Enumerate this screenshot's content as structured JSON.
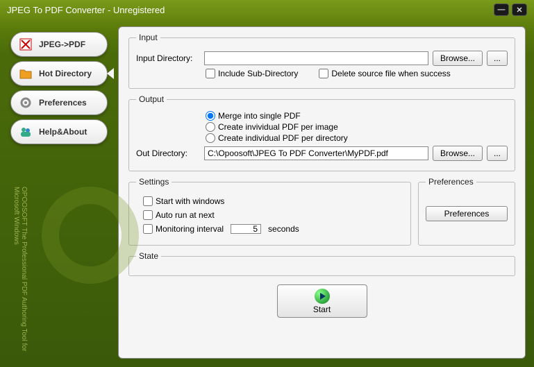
{
  "window": {
    "title": "JPEG To PDF Converter - Unregistered"
  },
  "nav": {
    "jpeg_pdf": "JPEG->PDF",
    "hot_dir": "Hot Directory",
    "prefs": "Preferences",
    "help": "Help&About"
  },
  "sidetext": "OPOOSOFT  The Professional PDF Authoring Tool for Microsoft Windows",
  "input": {
    "legend": "Input",
    "dir_label": "Input Directory:",
    "dir_value": "",
    "browse": "Browse...",
    "more": "...",
    "include_sub": "Include Sub-Directory",
    "delete_src": "Delete source file when success"
  },
  "output": {
    "legend": "Output",
    "opt_merge": "Merge into single PDF",
    "opt_per_image": "Create invividual PDF per image",
    "opt_per_dir": "Create individual PDF per directory",
    "out_dir_label": "Out Directory:",
    "out_dir_value": "C:\\Opoosoft\\JPEG To PDF Converter\\MyPDF.pdf",
    "browse": "Browse...",
    "more": "..."
  },
  "settings": {
    "legend": "Settings",
    "start_win": "Start with windows",
    "auto_run": "Auto run at next",
    "mon_interval": "Monitoring interval",
    "interval_value": "5",
    "seconds": "seconds"
  },
  "prefs_box": {
    "legend": "Preferences",
    "btn": "Preferences"
  },
  "state": {
    "legend": "State"
  },
  "start": {
    "label": "Start"
  }
}
